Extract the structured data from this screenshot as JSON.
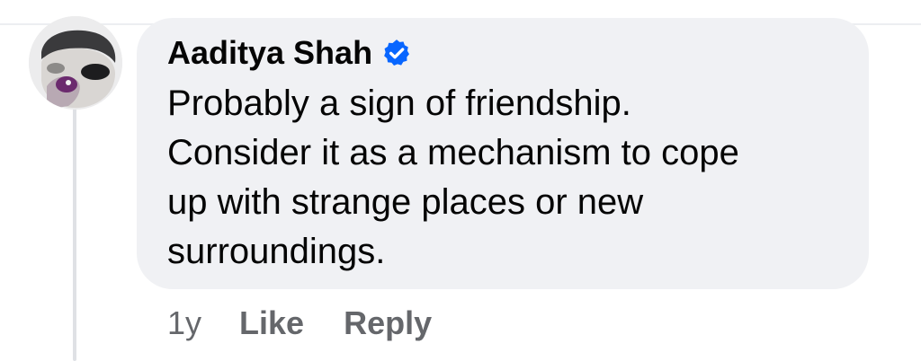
{
  "comment": {
    "author": "Aaditya Shah",
    "verified": true,
    "text": "Probably a sign of friendship.\nConsider it as a mechanism to cope\nup with strange places or new\nsurroundings.",
    "timestamp": "1y",
    "like_label": "Like",
    "reply_label": "Reply"
  },
  "colors": {
    "bubble": "#f0f1f4",
    "verified_badge": "#0866ff",
    "action_text": "#65676b",
    "primary_text": "#050505",
    "thread_line": "#dfe1e5"
  },
  "icons": {
    "avatar": "profile-photo",
    "verified": "verified-badge-icon"
  }
}
